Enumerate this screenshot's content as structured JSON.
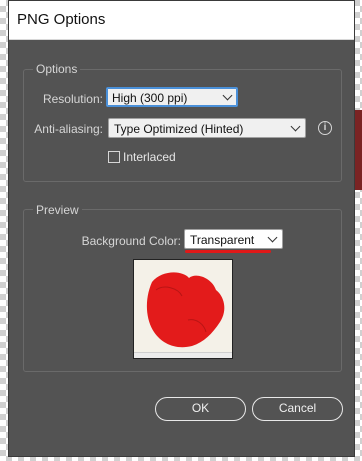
{
  "dialog": {
    "title": "PNG Options"
  },
  "options": {
    "group_title": "Options",
    "resolution": {
      "label": "Resolution:",
      "value": "High (300 ppi)"
    },
    "antialiasing": {
      "label": "Anti-aliasing:",
      "value": "Type Optimized (Hinted)"
    },
    "interlaced": {
      "label": "Interlaced",
      "checked": false
    },
    "info_icon": "info-icon"
  },
  "preview": {
    "group_title": "Preview",
    "background_color": {
      "label": "Background Color:",
      "value": "Transparent"
    },
    "annotation_color": "#e01818"
  },
  "buttons": {
    "ok": "OK",
    "cancel": "Cancel"
  }
}
